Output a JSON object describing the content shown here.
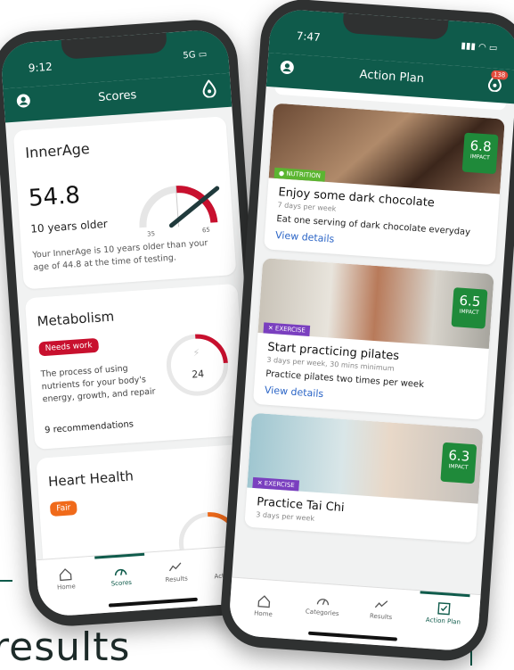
{
  "left_phone": {
    "status_time": "9:12",
    "status_signal": "5G",
    "header_title": "Scores",
    "innerage": {
      "title": "InnerAge",
      "value": "54.8",
      "subtitle": "10 years older",
      "gauge_min": "35",
      "gauge_max": "65",
      "description": "Your InnerAge is 10 years older than your age of 44.8 at the time of testing."
    },
    "metabolism": {
      "title": "Metabolism",
      "status": "Needs work",
      "description": "The process of using nutrients for your body's energy, growth, and repair",
      "score": "24",
      "recommendations": "9 recommendations"
    },
    "heart_health": {
      "title": "Heart Health",
      "status": "Fair"
    },
    "tabs": [
      {
        "label": "Home"
      },
      {
        "label": "Scores"
      },
      {
        "label": "Results"
      },
      {
        "label": "Action Plan"
      }
    ]
  },
  "right_phone": {
    "status_time": "7:47",
    "header_title": "Action Plan",
    "notification_count": "138",
    "actions": [
      {
        "category": "NUTRITION",
        "category_color": "#5bb531",
        "impact": "6.8",
        "impact_label": "IMPACT",
        "title": "Enjoy some dark chocolate",
        "frequency": "7 days per week",
        "description": "Eat one serving of dark chocolate everyday",
        "link": "View details"
      },
      {
        "category": "EXERCISE",
        "category_color": "#7a3fbf",
        "impact": "6.5",
        "impact_label": "IMPACT",
        "title": "Start practicing pilates",
        "frequency": "3 days per week, 30 mins minimum",
        "description": "Practice pilates two times per week",
        "link": "View details"
      },
      {
        "category": "EXERCISE",
        "category_color": "#7a3fbf",
        "impact": "6.3",
        "impact_label": "IMPACT",
        "title": "Practice Tai Chi",
        "frequency": "3 days per week"
      }
    ],
    "tabs": [
      {
        "label": "Home"
      },
      {
        "label": "Categories"
      },
      {
        "label": "Results"
      },
      {
        "label": "Action Plan"
      }
    ]
  },
  "background_text": "results"
}
